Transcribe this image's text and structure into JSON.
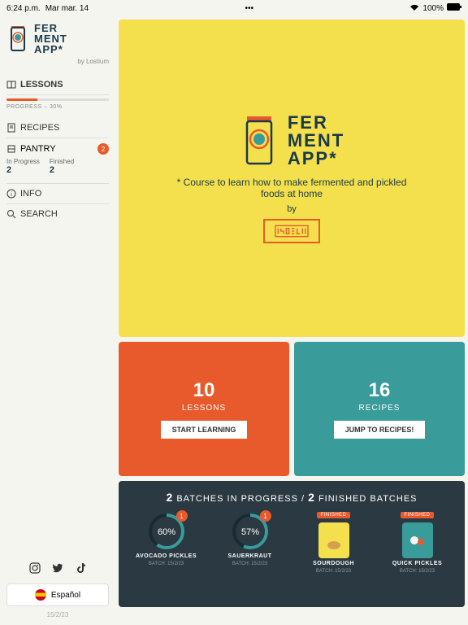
{
  "status": {
    "time": "6:24 p.m.",
    "date": "Mar mar. 14",
    "battery": "100%"
  },
  "logo": {
    "line1": "FER",
    "line2": "MENT",
    "line3": "APP*",
    "by": "by Lostium"
  },
  "nav": {
    "lessons": "LESSONS",
    "progress_label": "PROGRESS – 30%",
    "recipes": "RECIPES",
    "pantry": "PANTRY",
    "pantry_badge": "2",
    "pantry_in_progress_label": "In Progress",
    "pantry_in_progress_num": "2",
    "pantry_finished_label": "Finished",
    "pantry_finished_num": "2",
    "info": "INFO",
    "search": "SEARCH"
  },
  "lang": "Español",
  "sidebar_date": "15/2/23",
  "hero": {
    "line1": "FER",
    "line2": "MENT",
    "line3": "APP*",
    "tagline": "* Course to learn how to make fermented and pickled foods at home",
    "by": "by"
  },
  "cards": {
    "lessons_num": "10",
    "lessons_label": "LESSONS",
    "lessons_btn": "START LEARNING",
    "recipes_num": "16",
    "recipes_label": "RECIPES",
    "recipes_btn": "JUMP TO RECIPES!"
  },
  "batches": {
    "title_prefix": "2",
    "title_mid": " BATCHES IN PROGRESS / ",
    "title_suffix": "2",
    "title_end": " FINISHED BATCHES",
    "items": [
      {
        "pct": "60%",
        "name": "AVOCADO PICKLES",
        "date": "BATCH: 15/2/23",
        "badge": "1"
      },
      {
        "pct": "57%",
        "name": "SAUERKRAUT",
        "date": "BATCH: 15/2/23",
        "badge": "1"
      },
      {
        "finished": "FINISHED",
        "name": "SOURDOUGH",
        "date": "BATCH: 15/2/23"
      },
      {
        "finished": "FINISHED",
        "name": "QUICK PICKLES",
        "date": "BATCH: 15/2/23"
      }
    ]
  }
}
